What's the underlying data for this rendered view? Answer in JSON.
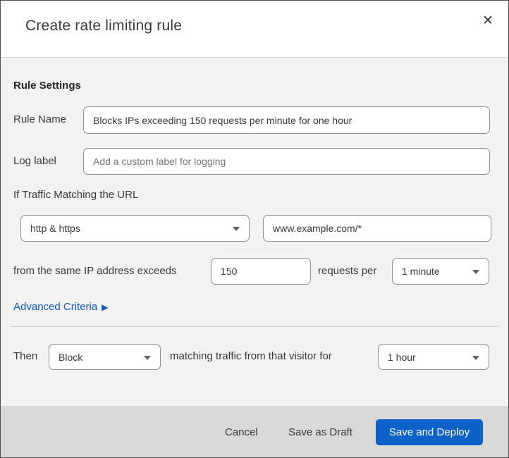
{
  "modal": {
    "title": "Create rate limiting rule",
    "close_glyph": "✕"
  },
  "form": {
    "section_heading": "Rule Settings",
    "rule_name": {
      "label": "Rule Name",
      "value": "Blocks IPs exceeding 150 requests per minute for one hour"
    },
    "log_label": {
      "label": "Log label",
      "placeholder": "Add a custom label for logging"
    },
    "traffic_match": {
      "heading": "If Traffic Matching the URL",
      "scheme_selected": "http & https",
      "url_value": "www.example.com/*"
    },
    "threshold": {
      "prefix": "from the same IP address exceeds",
      "requests_value": "150",
      "middle": "requests per",
      "period_selected": "1 minute"
    },
    "advanced_criteria": {
      "label": "Advanced Criteria",
      "arrow_glyph": "▶"
    },
    "then": {
      "label": "Then",
      "action_selected": "Block",
      "middle": "matching traffic from that visitor for",
      "duration_selected": "1 hour"
    }
  },
  "footer": {
    "cancel_label": "Cancel",
    "save_draft_label": "Save as Draft",
    "save_deploy_label": "Save and Deploy"
  },
  "colors": {
    "accent_blue": "#0d62c9",
    "link_blue": "#0b57c4",
    "topbar_navy": "#0c1e2c",
    "body_bg": "#f2f2f2",
    "footer_bg": "#d9d9d9"
  }
}
